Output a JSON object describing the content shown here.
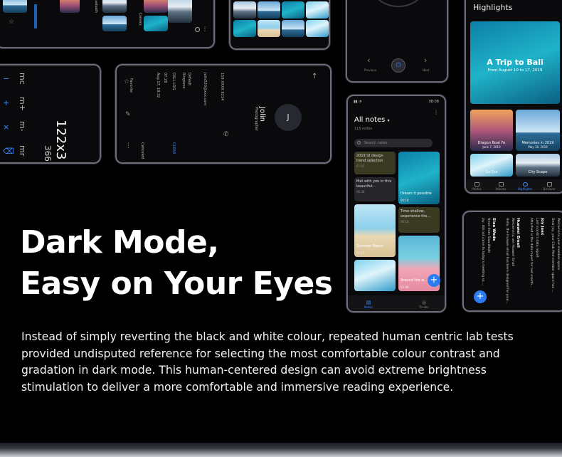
{
  "headline": {
    "line1": "Dark Mode,",
    "line2": "Easy on Your Eyes"
  },
  "body": "Instead of simply reverting the black and white colour, repeated human centric lab tests provided undisputed reference for selecting the most comfortable colour contrast and gradation in dark mode. This human-centered design can avoid extreme brightness stimulation to deliver a more comfortable and immersive reading experience.",
  "colors": {
    "background": "#000000",
    "accent": "#3b8cff",
    "frame": "#6a6a78"
  },
  "notes_phone": {
    "time": "08:08",
    "title": "All notes",
    "count": "115 notes",
    "search_placeholder": "Search notes",
    "notes": [
      {
        "text": "2019 UI design trend selection",
        "date": "07:07"
      },
      {
        "text": "Met with you in this beautiful...",
        "date": "06:38"
      },
      {
        "text": "Summer Beach",
        "date": "05:17"
      },
      {
        "text": "Dream it possible",
        "date": "06:18"
      },
      {
        "text": "Time shallow, experience the...",
        "date": "06:18"
      },
      {
        "text": "Around the w...",
        "date": "05:06"
      }
    ],
    "tabs": [
      "Notes",
      "To-dos"
    ],
    "fab_label": "+"
  },
  "highlights_phone": {
    "title": "Highlights",
    "hero_title": "A Trip to Bali",
    "hero_subtitle": "From August 10 to 17, 2019",
    "tiles": [
      {
        "title": "Dragon Boat Fe",
        "sub": "June 7, 2019"
      },
      {
        "title": "Memories in 2019",
        "sub": "May 18, 2019"
      },
      {
        "title": "Go Out",
        "sub": ""
      },
      {
        "title": "City Scape",
        "sub": ""
      }
    ],
    "tabs": [
      "Photos",
      "Albums",
      "Highlights",
      "Discover"
    ]
  },
  "email_phone": {
    "lines": [
      "Welcome to your member space",
      "Dear Joy, your Club Med member space has ...",
      "Joy Jaax",
      "Last month's data report",
      "Attached is the data report for last month...",
      "Huawei Email",
      "Welcome to use Huawei Email",
      "Hello, the Huawei email has been designed for your...",
      "Siaa Wede",
      "News from Siaa Wede",
      "Joy, did not come to today's meeting so ..."
    ],
    "fab_label": "+"
  },
  "calculator_phone": {
    "expression": "122x3",
    "result": "366",
    "keys": [
      "mc",
      "m+",
      "m-",
      "mr"
    ]
  },
  "contact_phone": {
    "initial": "J",
    "name": "Jolin",
    "subtitle": "Photographer",
    "number": "159 XXXX 9214",
    "email": "Jolin520@xxx.com",
    "default_label": "Default",
    "ringtone_label": "Ringtone",
    "call_log_label": "CALL LOG",
    "clear_label": "CLEAR",
    "call_time": "07:28",
    "call_date": "Aug 17, 18:32",
    "missed": "Canceled",
    "favorites_label": "Favorite"
  },
  "music_phone": {
    "prev_label": "Previous",
    "next_label": "Next"
  },
  "camera_phone": {
    "camera_label": "Camera",
    "bluetooth_label": "Bluetooth"
  }
}
